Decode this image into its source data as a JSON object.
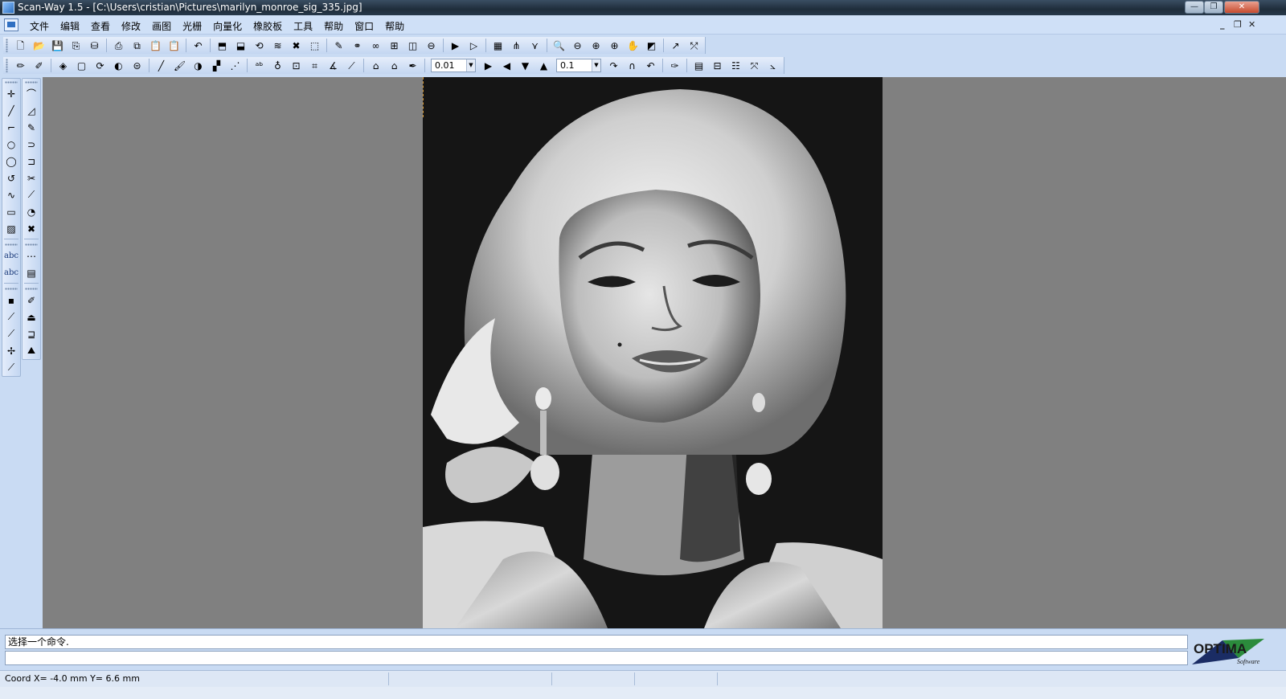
{
  "window": {
    "title": "Scan-Way 1.5 - [C:\\Users\\cristian\\Pictures\\marilyn_monroe_sig_335.jpg]",
    "minimize_glyph": "—",
    "maximize_glyph": "❐",
    "close_glyph": "✕",
    "mdi_minimize": "_",
    "mdi_restore": "❐",
    "mdi_close": "✕"
  },
  "menu": {
    "items": [
      "文件",
      "编辑",
      "查看",
      "修改",
      "画图",
      "光栅",
      "向量化",
      "橡胶板",
      "工具",
      "帮助",
      "窗口",
      "帮助"
    ]
  },
  "toolbar_top": {
    "icons": [
      {
        "name": "new-file-icon",
        "glyph": "🗋"
      },
      {
        "name": "open-folder-icon",
        "glyph": "📂"
      },
      {
        "name": "save-icon",
        "glyph": "💾"
      },
      {
        "name": "export-dxf-icon",
        "glyph": "⎘"
      },
      {
        "name": "save-all-icon",
        "glyph": "⛁"
      },
      {
        "name": "print-icon",
        "glyph": "⎙"
      },
      {
        "name": "copy-icon",
        "glyph": "⧉"
      },
      {
        "name": "paste-icon",
        "glyph": "📋"
      },
      {
        "name": "paste-special-icon",
        "glyph": "📋"
      },
      {
        "name": "undo-icon",
        "glyph": "↶"
      },
      {
        "name": "select-layer-icon",
        "glyph": "⬒"
      },
      {
        "name": "select-all-icon",
        "glyph": "⬓"
      },
      {
        "name": "transform-icon",
        "glyph": "⟲"
      },
      {
        "name": "layers-icon",
        "glyph": "≋"
      },
      {
        "name": "delete-icon",
        "glyph": "✖"
      },
      {
        "name": "select-rect-icon",
        "glyph": "⬚"
      },
      {
        "name": "eraser-icon",
        "glyph": "✎"
      },
      {
        "name": "link-icon",
        "glyph": "⚭"
      },
      {
        "name": "chain-icon",
        "glyph": "∞"
      },
      {
        "name": "grid-icon",
        "glyph": "⊞"
      },
      {
        "name": "mirror-vertical-icon",
        "glyph": "◫"
      },
      {
        "name": "mirror-horizontal-icon",
        "glyph": "⊖"
      },
      {
        "name": "play-icon",
        "glyph": "▶"
      },
      {
        "name": "play-outline-icon",
        "glyph": "▷"
      },
      {
        "name": "image-settings-icon",
        "glyph": "▦"
      },
      {
        "name": "vectorize-icon",
        "glyph": "⋔"
      },
      {
        "name": "trace-icon",
        "glyph": "⋎"
      },
      {
        "name": "zoom-out-icon",
        "glyph": "🔍"
      },
      {
        "name": "zoom-minus-icon",
        "glyph": "⊖"
      },
      {
        "name": "zoom-plus-icon",
        "glyph": "⊕"
      },
      {
        "name": "zoom-fit-icon",
        "glyph": "⊕"
      },
      {
        "name": "pan-icon",
        "glyph": "✋"
      },
      {
        "name": "zoom-window-icon",
        "glyph": "◩"
      },
      {
        "name": "arrow-line-icon",
        "glyph": "↗"
      },
      {
        "name": "arrow-cross-icon",
        "glyph": "⤱"
      }
    ]
  },
  "toolbar_second": {
    "combo1_value": "0.01",
    "combo2_value": "0.1",
    "icons_a": [
      {
        "name": "pencil-icon",
        "glyph": "✏"
      },
      {
        "name": "raster-eraser-icon",
        "glyph": "✐"
      },
      {
        "name": "fill-icon",
        "glyph": "◈"
      },
      {
        "name": "frame-icon",
        "glyph": "▢"
      },
      {
        "name": "rotate-icon",
        "glyph": "⟳"
      },
      {
        "name": "flip-icon",
        "glyph": "◐"
      },
      {
        "name": "stripe-icon",
        "glyph": "⊜"
      },
      {
        "name": "line-draw-icon",
        "glyph": "╱"
      },
      {
        "name": "brush-icon",
        "glyph": "🖌"
      },
      {
        "name": "invert-icon",
        "glyph": "◑"
      },
      {
        "name": "speckle-icon",
        "glyph": "▞"
      },
      {
        "name": "smooth-icon",
        "glyph": "⋰"
      },
      {
        "name": "text-recognize-icon",
        "glyph": "ᵃᵇ"
      },
      {
        "name": "balloon-icon",
        "glyph": "♁"
      },
      {
        "name": "lock-icon",
        "glyph": "⊡"
      },
      {
        "name": "crop-icon",
        "glyph": "⌗"
      },
      {
        "name": "angle-icon",
        "glyph": "∡"
      },
      {
        "name": "slash-icon",
        "glyph": "⟋"
      },
      {
        "name": "building-icon",
        "glyph": "⌂"
      },
      {
        "name": "house-icon",
        "glyph": "⌂"
      },
      {
        "name": "pipette-icon",
        "glyph": "✒"
      }
    ],
    "icons_b": [
      {
        "name": "triangle-right-icon",
        "glyph": "▶"
      },
      {
        "name": "triangle-left-icon",
        "glyph": "◀"
      },
      {
        "name": "triangle-down-icon",
        "glyph": "▼"
      },
      {
        "name": "triangle-up-icon",
        "glyph": "▲"
      }
    ],
    "icons_c": [
      {
        "name": "arc-cw-icon",
        "glyph": "↷"
      },
      {
        "name": "arc-half-icon",
        "glyph": "∩"
      },
      {
        "name": "arc-ccw-icon",
        "glyph": "↶"
      },
      {
        "name": "dropper-icon",
        "glyph": "✑"
      },
      {
        "name": "page-icon",
        "glyph": "▤"
      },
      {
        "name": "tile-icon",
        "glyph": "⊟"
      },
      {
        "name": "table-icon",
        "glyph": "☷"
      },
      {
        "name": "fit-icon",
        "glyph": "⤧"
      },
      {
        "name": "measure-icon",
        "glyph": "⦣"
      }
    ]
  },
  "palette_left": {
    "groups": [
      [
        {
          "name": "point-tool-icon",
          "glyph": "✛"
        },
        {
          "name": "line-tool-icon",
          "glyph": "╱"
        },
        {
          "name": "polyline-tool-icon",
          "glyph": "⌐"
        },
        {
          "name": "circle-tool-icon",
          "glyph": "○"
        },
        {
          "name": "circle-3pt-tool-icon",
          "glyph": "◯"
        },
        {
          "name": "arc-tool-icon",
          "glyph": "↺"
        },
        {
          "name": "curve-tool-icon",
          "glyph": "∿"
        },
        {
          "name": "rectangle-tool-icon",
          "glyph": "▭"
        },
        {
          "name": "hatch-tool-icon",
          "glyph": "▨"
        }
      ],
      [
        {
          "name": "text-tool-icon",
          "glyph": "abc",
          "text": true
        },
        {
          "name": "text-path-tool-icon",
          "glyph": "abc",
          "text": true
        }
      ],
      [
        {
          "name": "node-tool-icon",
          "glyph": "▪"
        },
        {
          "name": "snap-line-icon",
          "glyph": "⟋"
        },
        {
          "name": "snap-end-icon",
          "glyph": "⟋"
        },
        {
          "name": "snap-center-icon",
          "glyph": "✢"
        },
        {
          "name": "snap-perp-icon",
          "glyph": "⟋"
        }
      ]
    ]
  },
  "palette_right": {
    "groups": [
      [
        {
          "name": "bezier-tool-icon",
          "glyph": "⌒"
        },
        {
          "name": "angle-tool-icon",
          "glyph": "◿"
        },
        {
          "name": "edit-tool-icon",
          "glyph": "✎"
        },
        {
          "name": "spiral-tool-icon",
          "glyph": "⊃"
        },
        {
          "name": "fillet-tool-icon",
          "glyph": "⊐"
        },
        {
          "name": "scissors-tool-icon",
          "glyph": "✂"
        },
        {
          "name": "ruler-tool-icon",
          "glyph": "⟋"
        },
        {
          "name": "ellipse-tool-icon",
          "glyph": "◔"
        },
        {
          "name": "explode-tool-icon",
          "glyph": "✖"
        }
      ],
      [
        {
          "name": "dash-tool-icon",
          "glyph": "⋯"
        },
        {
          "name": "pattern-tool-icon",
          "glyph": "▤"
        }
      ],
      [
        {
          "name": "marker-tool-icon",
          "glyph": "✐"
        },
        {
          "name": "bell-tool-icon",
          "glyph": "⏏"
        },
        {
          "name": "offset-tool-icon",
          "glyph": "⊒"
        },
        {
          "name": "mountain-tool-icon",
          "glyph": "⛰"
        }
      ]
    ]
  },
  "command": {
    "prompt": "选择一个命令.",
    "input": ""
  },
  "logo": {
    "brand": "OPTIMA",
    "sub": "Software"
  },
  "status": {
    "coord": "Coord X= -4.0 mm  Y= 6.6 mm"
  }
}
